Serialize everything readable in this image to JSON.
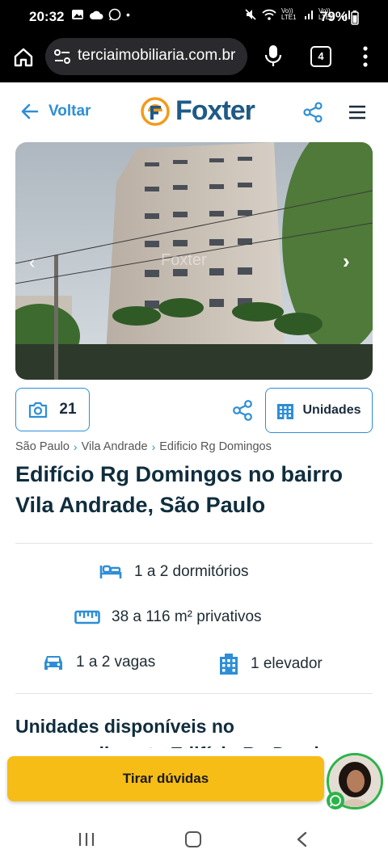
{
  "status_bar": {
    "time": "20:32",
    "signal_labels": [
      "Vo)) LTE1",
      "Vo)) LTE2"
    ],
    "battery": "79%"
  },
  "browser": {
    "url": "terciaimobiliaria.com.br",
    "tab_count": "4"
  },
  "header": {
    "back_label": "Voltar",
    "logo_text": "Foxter",
    "accent_color": "#2d8ed6",
    "brand_color": "#1e5a87",
    "logo_orange": "#f39a1a"
  },
  "gallery": {
    "photo_count": "21",
    "units_label": "Unidades",
    "watermark": "Foxter"
  },
  "breadcrumbs": [
    "São Paulo",
    "Vila Andrade",
    "Edificio Rg Domingos"
  ],
  "title": "Edifício Rg Domingos no bairro Vila Andrade, São Paulo",
  "features": {
    "bedrooms": "1 a 2 dormitórios",
    "area": "38 a 116 m² privativos",
    "parking": "1 a 2 vagas",
    "elevator": "1 elevador"
  },
  "section_title": "Unidades disponíveis no empreendimento Edifício Rg Domingos",
  "cta_label": "Tirar dúvidas",
  "cta_color": "#f7bd17"
}
